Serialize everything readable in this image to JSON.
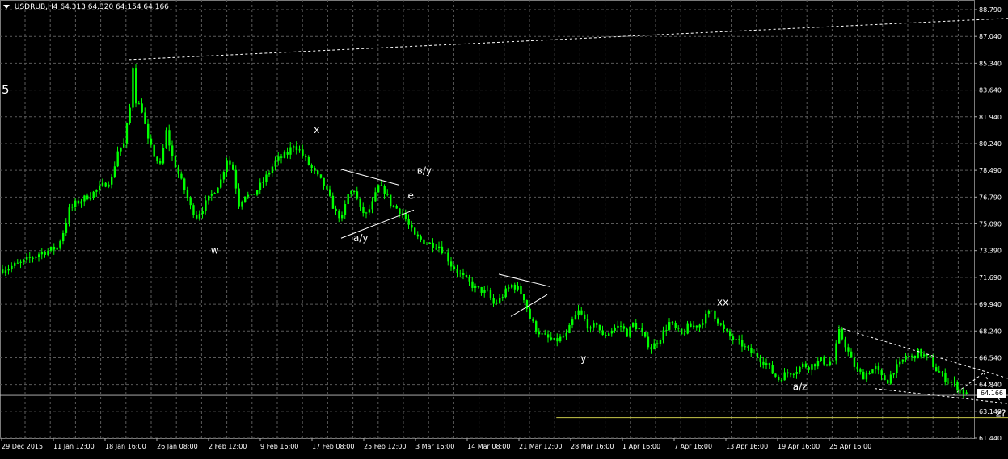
{
  "header": {
    "symbol": "USDRUB,H4",
    "ohlc": "64.313 64.320 64.154 64.166"
  },
  "side_label": "5",
  "current_price_label": "64.166",
  "colors": {
    "background": "#000000",
    "grid": "#5a5a5a",
    "candle": "#00ff00",
    "text": "#ffffff",
    "level": "#c8c84a"
  },
  "chart_data": {
    "type": "candlestick",
    "x_tick_labels": [
      "29 Dec 2015",
      "11 Jan 12:00",
      "18 Jan 16:00",
      "26 Jan 08:00",
      "2 Feb 12:00",
      "9 Feb 16:00",
      "17 Feb 08:00",
      "25 Feb 12:00",
      "3 Mar 16:00",
      "14 Mar 08:00",
      "21 Mar 12:00",
      "28 Mar 16:00",
      "1 Apr 16:00",
      "7 Apr 16:00",
      "13 Apr 16:00",
      "19 Apr 16:00",
      "25 Apr 16:00"
    ],
    "y_tick_labels": [
      "88.790",
      "87.040",
      "85.340",
      "83.640",
      "81.940",
      "80.240",
      "78.490",
      "76.790",
      "75.090",
      "73.390",
      "71.690",
      "69.940",
      "68.240",
      "66.540",
      "64.840",
      "63.140",
      "61.440"
    ],
    "ylim": [
      61.44,
      88.79
    ],
    "grid": true,
    "last_price": 64.166,
    "wave_labels": [
      "w",
      "x",
      "в/у",
      "e",
      "a/y",
      "y",
      "xx",
      "a/z",
      "z?"
    ],
    "path": [
      [
        0,
        72.2
      ],
      [
        3,
        72.6
      ],
      [
        6,
        73.2
      ],
      [
        9,
        73.6
      ],
      [
        10,
        74.6
      ],
      [
        11,
        76.0
      ],
      [
        12,
        76.4
      ],
      [
        15,
        77.1
      ],
      [
        18,
        78.0
      ],
      [
        19,
        79.8
      ],
      [
        20,
        80.2
      ],
      [
        21,
        82.5
      ],
      [
        21.5,
        85.2
      ],
      [
        22,
        83.0
      ],
      [
        23,
        82.4
      ],
      [
        24,
        80.4
      ],
      [
        25,
        79.5
      ],
      [
        26,
        78.8
      ],
      [
        27,
        81.0
      ],
      [
        28,
        79.4
      ],
      [
        29,
        78.3
      ],
      [
        30,
        77.3
      ],
      [
        31,
        76.2
      ],
      [
        32,
        75.6
      ],
      [
        34,
        76.7
      ],
      [
        36,
        77.9
      ],
      [
        37,
        79.3
      ],
      [
        38,
        78.6
      ],
      [
        39,
        76.4
      ],
      [
        40,
        77.0
      ],
      [
        41,
        76.8
      ],
      [
        43,
        77.8
      ],
      [
        45,
        79.1
      ],
      [
        47,
        79.6
      ],
      [
        48,
        80.2
      ],
      [
        49,
        79.8
      ],
      [
        50,
        79.2
      ],
      [
        52,
        78.1
      ],
      [
        53,
        77.6
      ],
      [
        54,
        76.7
      ],
      [
        55,
        75.8
      ],
      [
        56,
        75.5
      ],
      [
        57,
        77.0
      ],
      [
        58,
        77.3
      ],
      [
        59,
        76.0
      ],
      [
        60,
        75.7
      ],
      [
        61,
        76.4
      ],
      [
        62,
        77.5
      ],
      [
        63,
        77.2
      ],
      [
        64,
        76.4
      ],
      [
        66,
        75.8
      ],
      [
        67,
        75.0
      ],
      [
        68,
        74.3
      ],
      [
        70,
        73.9
      ],
      [
        72,
        73.7
      ],
      [
        73,
        73.2
      ],
      [
        74,
        72.5
      ],
      [
        75,
        72.1
      ],
      [
        76,
        71.7
      ],
      [
        78,
        71.0
      ],
      [
        80,
        70.7
      ],
      [
        81,
        70.0
      ],
      [
        82,
        70.3
      ],
      [
        83,
        70.8
      ],
      [
        84,
        71.2
      ],
      [
        85,
        71.0
      ],
      [
        86,
        70.4
      ],
      [
        87,
        69.1
      ],
      [
        88,
        68.4
      ],
      [
        89,
        68.0
      ],
      [
        90,
        67.8
      ],
      [
        91,
        67.6
      ],
      [
        93,
        68.0
      ],
      [
        94,
        68.9
      ],
      [
        95,
        69.5
      ],
      [
        96,
        69.0
      ],
      [
        97,
        68.3
      ],
      [
        98,
        68.8
      ],
      [
        99,
        67.9
      ],
      [
        101,
        68.5
      ],
      [
        102,
        68.6
      ],
      [
        103,
        68.1
      ],
      [
        104,
        68.7
      ],
      [
        105,
        68.4
      ],
      [
        106,
        67.7
      ],
      [
        107,
        67.2
      ],
      [
        108,
        67.6
      ],
      [
        109,
        68.2
      ],
      [
        110,
        68.8
      ],
      [
        112,
        68.0
      ],
      [
        113,
        68.5
      ],
      [
        115,
        68.7
      ],
      [
        116,
        69.2
      ],
      [
        117,
        69.6
      ],
      [
        118,
        68.9
      ],
      [
        119,
        68.3
      ],
      [
        120,
        67.9
      ],
      [
        121,
        67.6
      ],
      [
        122,
        67.4
      ],
      [
        123,
        67.0
      ],
      [
        124,
        66.8
      ],
      [
        125,
        66.5
      ],
      [
        126,
        66.2
      ],
      [
        127,
        65.6
      ],
      [
        128,
        65.2
      ],
      [
        129,
        65.5
      ],
      [
        131,
        65.8
      ],
      [
        132,
        66.1
      ],
      [
        133,
        66.0
      ],
      [
        135,
        66.4
      ],
      [
        136,
        66.2
      ],
      [
        137,
        66.4
      ],
      [
        138,
        68.2
      ],
      [
        139,
        67.4
      ],
      [
        140,
        66.4
      ],
      [
        141,
        65.7
      ],
      [
        142,
        65.4
      ],
      [
        143,
        65.7
      ],
      [
        144,
        65.9
      ],
      [
        145,
        65.3
      ],
      [
        146,
        65.1
      ],
      [
        147,
        65.8
      ],
      [
        148,
        66.1
      ],
      [
        149,
        66.7
      ],
      [
        150,
        66.6
      ],
      [
        151,
        66.9
      ],
      [
        152,
        66.7
      ],
      [
        153,
        66.4
      ],
      [
        154,
        65.8
      ],
      [
        155,
        65.4
      ],
      [
        156,
        65.1
      ],
      [
        157,
        64.9
      ],
      [
        158,
        64.5
      ],
      [
        159,
        64.2
      ]
    ],
    "chart_lines": [
      {
        "kind": "dashed",
        "from": [
          21,
          85.6
        ],
        "to": [
          186,
          88.6
        ]
      },
      {
        "kind": "solid",
        "from": [
          56,
          78.6
        ],
        "to": [
          65.5,
          77.6
        ]
      },
      {
        "kind": "solid",
        "from": [
          56,
          74.2
        ],
        "to": [
          68,
          76.0
        ]
      },
      {
        "kind": "solid",
        "from": [
          82,
          71.9
        ],
        "to": [
          90.5,
          71.1
        ]
      },
      {
        "kind": "solid",
        "from": [
          84,
          69.2
        ],
        "to": [
          90,
          70.6
        ]
      },
      {
        "kind": "dashed",
        "from": [
          138,
          68.5
        ],
        "to": [
          169,
          64.9
        ]
      },
      {
        "kind": "dashed",
        "from": [
          144,
          64.6
        ],
        "to": [
          174,
          63.3
        ]
      },
      {
        "kind": "dashed",
        "from": [
          157,
          64.2
        ],
        "to": [
          162,
          65.6
        ]
      },
      {
        "kind": "dashed",
        "from": [
          162,
          65.6
        ],
        "to": [
          165,
          63.6
        ]
      },
      {
        "kind": "solid",
        "from": [
          -1,
          64.166
        ],
        "to": [
          186,
          64.166
        ],
        "stroke": "#c0c0c0",
        "width": 0.8
      },
      {
        "kind": "solid",
        "from": [
          91.5,
          62.75
        ],
        "to": [
          186,
          62.75
        ],
        "stroke": "#c8c84a",
        "width": 1
      }
    ],
    "wave_label_positions": [
      [
        34.5,
        73.2
      ],
      [
        51.5,
        80.9
      ],
      [
        68.5,
        78.3
      ],
      [
        67,
        76.7
      ],
      [
        58,
        74.0
      ],
      [
        95.5,
        66.3
      ],
      [
        118,
        69.9
      ],
      [
        130.5,
        64.5
      ],
      [
        164,
        62.8
      ]
    ]
  }
}
